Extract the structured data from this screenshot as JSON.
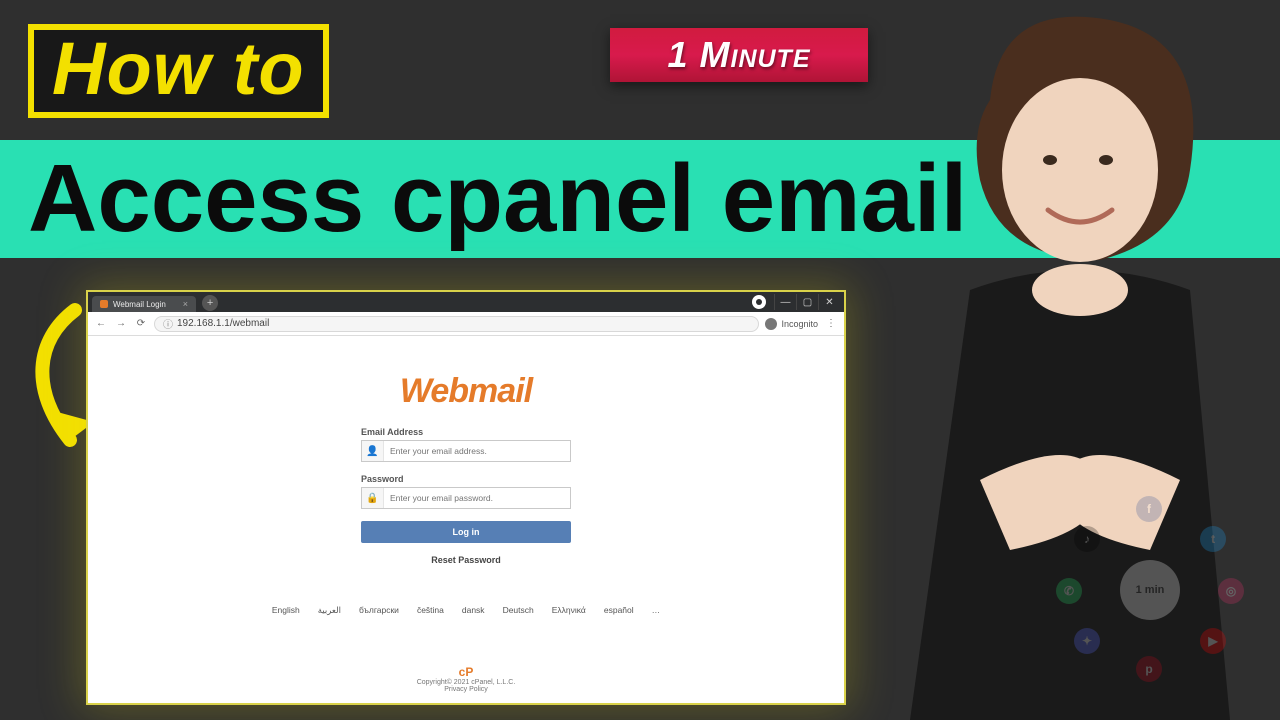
{
  "thumb": {
    "howto_label": "How to",
    "minute_label": "1 Minute",
    "subtitle": "Access cpanel email"
  },
  "browser": {
    "tab_title": "Webmail Login",
    "url": "192.168.1.1/webmail",
    "incognito_label": "Incognito",
    "window_buttons": {
      "min": "—",
      "max": "▢",
      "close": "✕"
    },
    "menu_dots": "⋮"
  },
  "webmail": {
    "logo": "Webmail",
    "email_label": "Email Address",
    "email_placeholder": "Enter your email address.",
    "password_label": "Password",
    "password_placeholder": "Enter your email password.",
    "login_button": "Log in",
    "reset_link": "Reset Password",
    "languages": [
      "English",
      "العربية",
      "български",
      "čeština",
      "dansk",
      "Deutsch",
      "Ελληνικά",
      "español",
      "…"
    ],
    "footer_brand": "cP",
    "copyright": "Copyright© 2021 cPanel, L.L.C.",
    "privacy": "Privacy Policy"
  },
  "watermark": {
    "core": "1 min"
  }
}
